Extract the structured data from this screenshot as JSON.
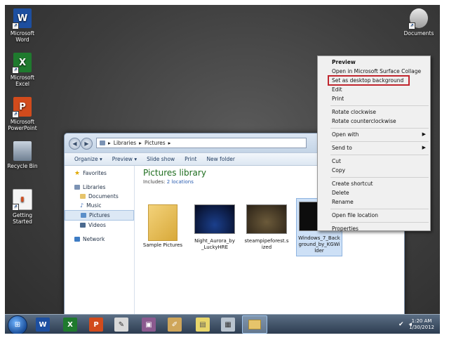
{
  "desktop_icons": [
    {
      "label": "Microsoft Word",
      "icon": "word-icon"
    },
    {
      "label": "Microsoft Excel",
      "icon": "excel-icon"
    },
    {
      "label": "Microsoft PowerPoint",
      "icon": "powerpoint-icon"
    },
    {
      "label": "Recycle Bin",
      "icon": "recycle-bin-icon"
    },
    {
      "label": "Getting Started",
      "icon": "getting-started-icon"
    },
    {
      "label": "Documents",
      "icon": "documents-icon"
    }
  ],
  "explorer": {
    "breadcrumb": [
      "Libraries",
      "Pictures"
    ],
    "toolbar": [
      "Organize ▾",
      "Preview ▾",
      "Slide show",
      "Print",
      "New folder"
    ],
    "nav": {
      "favorites": "Favorites",
      "libraries": "Libraries",
      "documents": "Documents",
      "music": "Music",
      "pictures": "Pictures",
      "videos": "Videos",
      "network": "Network"
    },
    "library_title": "Pictures library",
    "includes_label": "Includes:",
    "includes_link": "2 locations",
    "files": [
      {
        "name": "Sample Pictures"
      },
      {
        "name": "Night_Aurora_by _LuckyHRE"
      },
      {
        "name": "steampipeforest.s ized"
      },
      {
        "name": "Windows_7_Back ground_by_KGWi lder"
      }
    ]
  },
  "context_menu": {
    "items": [
      {
        "label": "Preview",
        "bold": true
      },
      {
        "label": "Open in Microsoft Surface Collage"
      },
      {
        "label": "Set as desktop background",
        "highlight": true
      },
      {
        "label": "Edit"
      },
      {
        "label": "Print"
      },
      {
        "separator": true
      },
      {
        "label": "Rotate clockwise"
      },
      {
        "label": "Rotate counterclockwise"
      },
      {
        "separator": true
      },
      {
        "label": "Open with",
        "submenu": true
      },
      {
        "separator": true
      },
      {
        "label": "Send to",
        "submenu": true
      },
      {
        "separator": true
      },
      {
        "label": "Cut"
      },
      {
        "label": "Copy"
      },
      {
        "separator": true
      },
      {
        "label": "Create shortcut"
      },
      {
        "label": "Delete"
      },
      {
        "label": "Rename"
      },
      {
        "separator": true
      },
      {
        "label": "Open file location"
      },
      {
        "separator": true
      },
      {
        "label": "Properties"
      }
    ]
  },
  "taskbar": {
    "clock_time": "1:20 AM",
    "clock_date": "1/30/2012"
  },
  "colors": {
    "highlight_border": "#c0262e",
    "library_title": "#1e6d1e"
  }
}
